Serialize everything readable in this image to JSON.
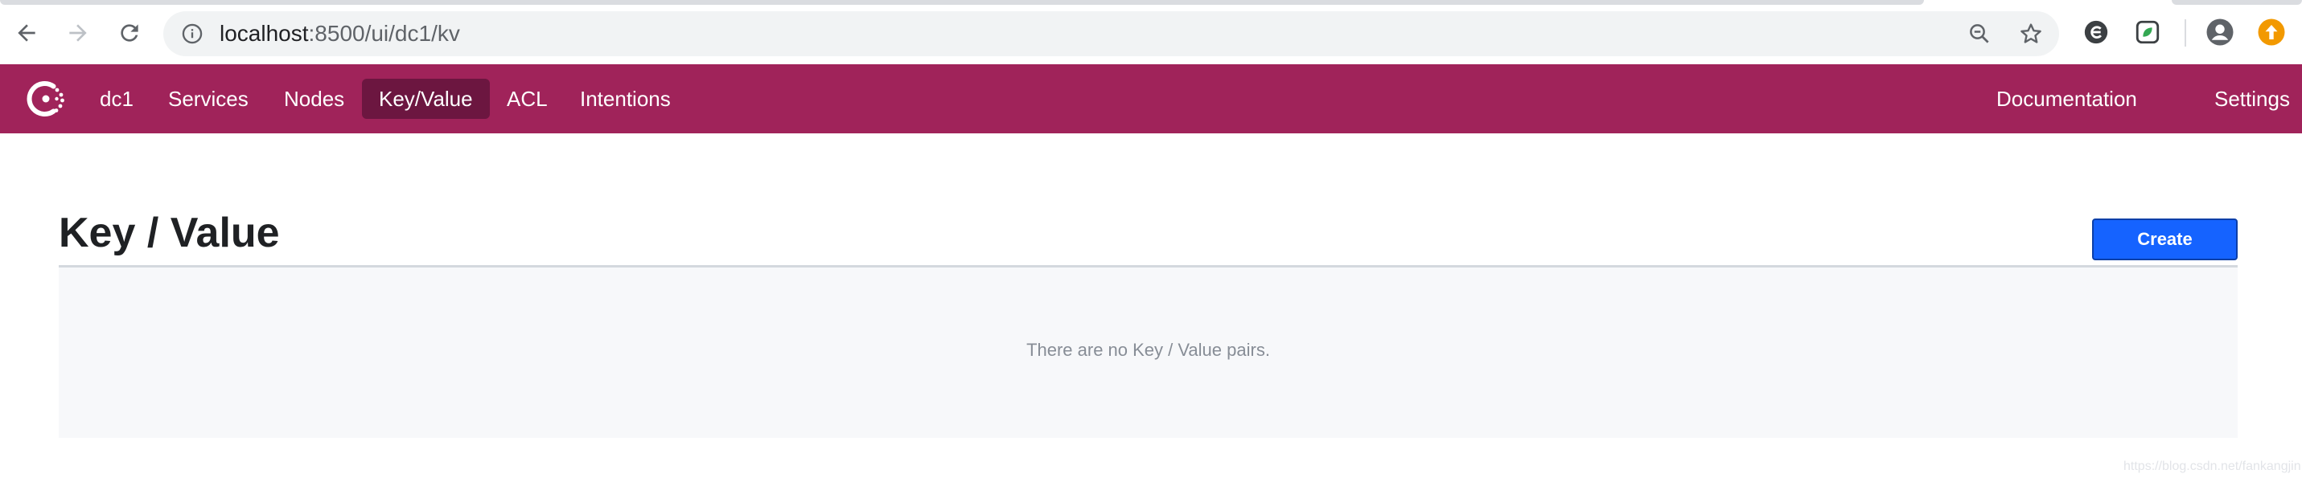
{
  "browser": {
    "url_host": "localhost",
    "url_path": ":8500/ui/dc1/kv",
    "icons": {
      "back": "back-arrow-icon",
      "forward": "forward-arrow-icon",
      "reload": "reload-icon",
      "info": "info-icon",
      "zoom": "zoom-out-icon",
      "bookmark": "star-icon",
      "extensions": [
        "extension-e-icon",
        "extension-leaf-icon"
      ],
      "profile": "profile-icon",
      "update": "update-icon"
    },
    "colors": {
      "omnibox": "#f1f3f4",
      "update_badge": "#f29900"
    }
  },
  "nav": {
    "datacenter": "dc1",
    "items": [
      {
        "label": "Services",
        "active": false
      },
      {
        "label": "Nodes",
        "active": false
      },
      {
        "label": "Key/Value",
        "active": true
      },
      {
        "label": "ACL",
        "active": false
      },
      {
        "label": "Intentions",
        "active": false
      }
    ],
    "right_items": [
      {
        "label": "Documentation"
      },
      {
        "label": "Settings"
      }
    ],
    "colors": {
      "background": "#a0235a",
      "active": "#6c1640"
    }
  },
  "main": {
    "title": "Key / Value",
    "create_label": "Create",
    "empty_message": "There are no Key / Value pairs.",
    "colors": {
      "create_button": "#1563ff",
      "empty_bg": "#f7f8fa"
    }
  },
  "watermark": "https://blog.csdn.net/fankangjin"
}
